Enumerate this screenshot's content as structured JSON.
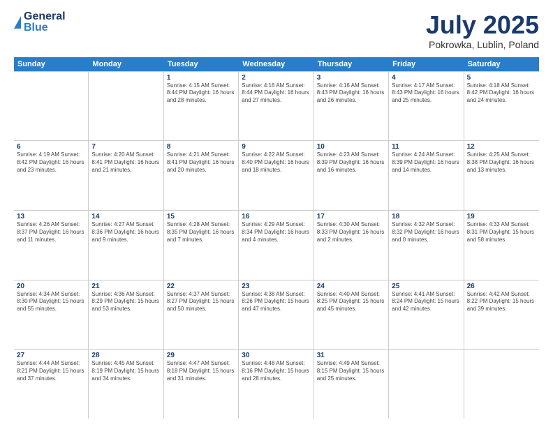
{
  "header": {
    "logo": {
      "general": "General",
      "blue": "Blue"
    },
    "title": "July 2025",
    "subtitle": "Pokrowka, Lublin, Poland"
  },
  "calendar": {
    "weekdays": [
      "Sunday",
      "Monday",
      "Tuesday",
      "Wednesday",
      "Thursday",
      "Friday",
      "Saturday"
    ],
    "rows": [
      [
        {
          "day": "",
          "info": ""
        },
        {
          "day": "",
          "info": ""
        },
        {
          "day": "1",
          "info": "Sunrise: 4:15 AM\nSunset: 8:44 PM\nDaylight: 16 hours\nand 28 minutes."
        },
        {
          "day": "2",
          "info": "Sunrise: 4:16 AM\nSunset: 8:44 PM\nDaylight: 16 hours\nand 27 minutes."
        },
        {
          "day": "3",
          "info": "Sunrise: 4:16 AM\nSunset: 8:43 PM\nDaylight: 16 hours\nand 26 minutes."
        },
        {
          "day": "4",
          "info": "Sunrise: 4:17 AM\nSunset: 8:43 PM\nDaylight: 16 hours\nand 25 minutes."
        },
        {
          "day": "5",
          "info": "Sunrise: 4:18 AM\nSunset: 8:42 PM\nDaylight: 16 hours\nand 24 minutes."
        }
      ],
      [
        {
          "day": "6",
          "info": "Sunrise: 4:19 AM\nSunset: 8:42 PM\nDaylight: 16 hours\nand 23 minutes."
        },
        {
          "day": "7",
          "info": "Sunrise: 4:20 AM\nSunset: 8:41 PM\nDaylight: 16 hours\nand 21 minutes."
        },
        {
          "day": "8",
          "info": "Sunrise: 4:21 AM\nSunset: 8:41 PM\nDaylight: 16 hours\nand 20 minutes."
        },
        {
          "day": "9",
          "info": "Sunrise: 4:22 AM\nSunset: 8:40 PM\nDaylight: 16 hours\nand 18 minutes."
        },
        {
          "day": "10",
          "info": "Sunrise: 4:23 AM\nSunset: 8:39 PM\nDaylight: 16 hours\nand 16 minutes."
        },
        {
          "day": "11",
          "info": "Sunrise: 4:24 AM\nSunset: 8:39 PM\nDaylight: 16 hours\nand 14 minutes."
        },
        {
          "day": "12",
          "info": "Sunrise: 4:25 AM\nSunset: 8:38 PM\nDaylight: 16 hours\nand 13 minutes."
        }
      ],
      [
        {
          "day": "13",
          "info": "Sunrise: 4:26 AM\nSunset: 8:37 PM\nDaylight: 16 hours\nand 11 minutes."
        },
        {
          "day": "14",
          "info": "Sunrise: 4:27 AM\nSunset: 8:36 PM\nDaylight: 16 hours\nand 9 minutes."
        },
        {
          "day": "15",
          "info": "Sunrise: 4:28 AM\nSunset: 8:35 PM\nDaylight: 16 hours\nand 7 minutes."
        },
        {
          "day": "16",
          "info": "Sunrise: 4:29 AM\nSunset: 8:34 PM\nDaylight: 16 hours\nand 4 minutes."
        },
        {
          "day": "17",
          "info": "Sunrise: 4:30 AM\nSunset: 8:33 PM\nDaylight: 16 hours\nand 2 minutes."
        },
        {
          "day": "18",
          "info": "Sunrise: 4:32 AM\nSunset: 8:32 PM\nDaylight: 16 hours\nand 0 minutes."
        },
        {
          "day": "19",
          "info": "Sunrise: 4:33 AM\nSunset: 8:31 PM\nDaylight: 15 hours\nand 58 minutes."
        }
      ],
      [
        {
          "day": "20",
          "info": "Sunrise: 4:34 AM\nSunset: 8:30 PM\nDaylight: 15 hours\nand 55 minutes."
        },
        {
          "day": "21",
          "info": "Sunrise: 4:36 AM\nSunset: 8:29 PM\nDaylight: 15 hours\nand 53 minutes."
        },
        {
          "day": "22",
          "info": "Sunrise: 4:37 AM\nSunset: 8:27 PM\nDaylight: 15 hours\nand 50 minutes."
        },
        {
          "day": "23",
          "info": "Sunrise: 4:38 AM\nSunset: 8:26 PM\nDaylight: 15 hours\nand 47 minutes."
        },
        {
          "day": "24",
          "info": "Sunrise: 4:40 AM\nSunset: 8:25 PM\nDaylight: 15 hours\nand 45 minutes."
        },
        {
          "day": "25",
          "info": "Sunrise: 4:41 AM\nSunset: 8:24 PM\nDaylight: 15 hours\nand 42 minutes."
        },
        {
          "day": "26",
          "info": "Sunrise: 4:42 AM\nSunset: 8:22 PM\nDaylight: 15 hours\nand 39 minutes."
        }
      ],
      [
        {
          "day": "27",
          "info": "Sunrise: 4:44 AM\nSunset: 8:21 PM\nDaylight: 15 hours\nand 37 minutes."
        },
        {
          "day": "28",
          "info": "Sunrise: 4:45 AM\nSunset: 8:19 PM\nDaylight: 15 hours\nand 34 minutes."
        },
        {
          "day": "29",
          "info": "Sunrise: 4:47 AM\nSunset: 8:18 PM\nDaylight: 15 hours\nand 31 minutes."
        },
        {
          "day": "30",
          "info": "Sunrise: 4:48 AM\nSunset: 8:16 PM\nDaylight: 15 hours\nand 28 minutes."
        },
        {
          "day": "31",
          "info": "Sunrise: 4:49 AM\nSunset: 8:15 PM\nDaylight: 15 hours\nand 25 minutes."
        },
        {
          "day": "",
          "info": ""
        },
        {
          "day": "",
          "info": ""
        }
      ]
    ]
  }
}
